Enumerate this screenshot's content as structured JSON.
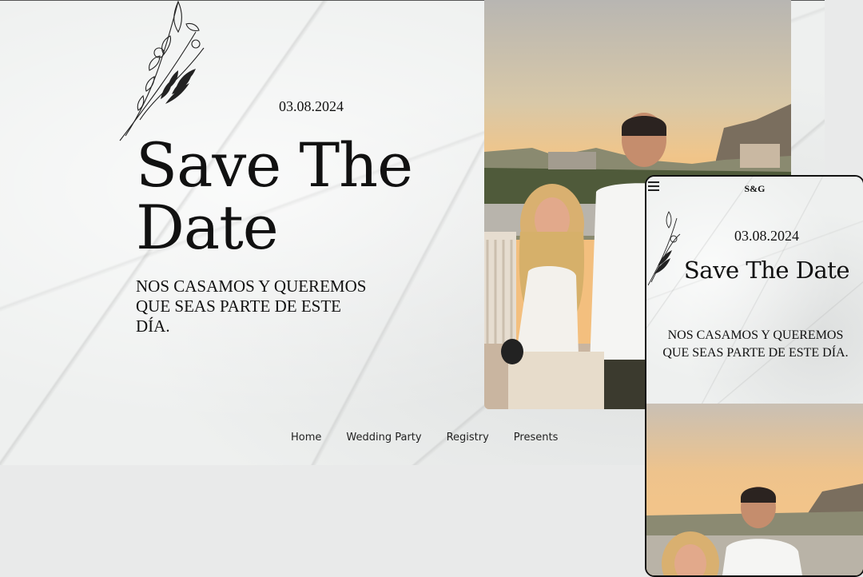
{
  "desktop": {
    "date": "03.08.2024",
    "title": "Save The Date",
    "tagline": "NOS CASAMOS Y QUEREMOS QUE SEAS PARTE DE ESTE DÍA.",
    "nav": [
      "Home",
      "Wedding Party",
      "Registry",
      "Presents"
    ]
  },
  "mobile": {
    "logo": "S&G",
    "date": "03.08.2024",
    "title": "Save The Date",
    "tagline": "NOS CASAMOS Y QUEREMOS QUE SEAS PARTE DE ESTE DÍA."
  },
  "icons": {
    "floral": "botanical-sprig-icon",
    "menu": "hamburger-menu-icon"
  },
  "colors": {
    "text": "#111111",
    "marble": "#eef0ef",
    "page_bg": "#e9eaea"
  }
}
